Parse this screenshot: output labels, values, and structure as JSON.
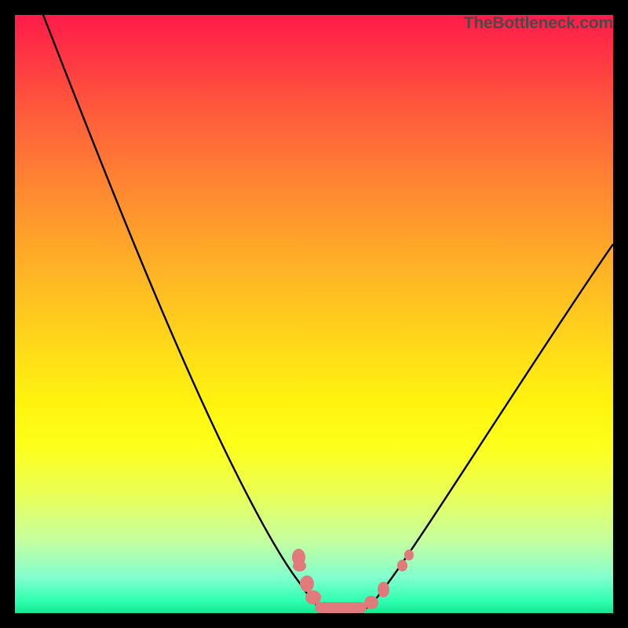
{
  "attribution": "TheBottleneck.com",
  "colors": {
    "frame": "#000000",
    "curve": "#000000",
    "marker": "#e17a7a",
    "gradient_top": "#ff1b4a",
    "gradient_bottom": "#14e892"
  },
  "chart_data": {
    "type": "line",
    "title": "",
    "xlabel": "",
    "ylabel": "",
    "xlim": [
      0,
      100
    ],
    "ylim": [
      0,
      100
    ],
    "series": [
      {
        "name": "left-branch",
        "x": [
          5,
          10,
          15,
          20,
          25,
          30,
          35,
          40,
          45,
          48,
          50,
          52,
          54
        ],
        "y": [
          100,
          89,
          79,
          69,
          58,
          47,
          36,
          24,
          12,
          6,
          2,
          0,
          0
        ]
      },
      {
        "name": "right-branch",
        "x": [
          54,
          56,
          58,
          60,
          62,
          65,
          70,
          75,
          80,
          85,
          90,
          95,
          100
        ],
        "y": [
          0,
          0,
          0,
          1,
          3,
          6,
          13,
          21,
          29,
          38,
          47,
          55,
          63
        ]
      }
    ],
    "markers": [
      {
        "name": "left-cluster-top",
        "x": 47.5,
        "y": 9
      },
      {
        "name": "left-cluster-low",
        "x": 48.5,
        "y": 5
      },
      {
        "name": "floor-pill",
        "x_start": 50,
        "x_end": 58,
        "y": 0
      },
      {
        "name": "right-marker-low",
        "x": 61,
        "y": 2
      },
      {
        "name": "right-marker-mid",
        "x": 63,
        "y": 5
      },
      {
        "name": "right-marker-high",
        "x": 66,
        "y": 8
      }
    ],
    "legend": false,
    "grid": false
  }
}
